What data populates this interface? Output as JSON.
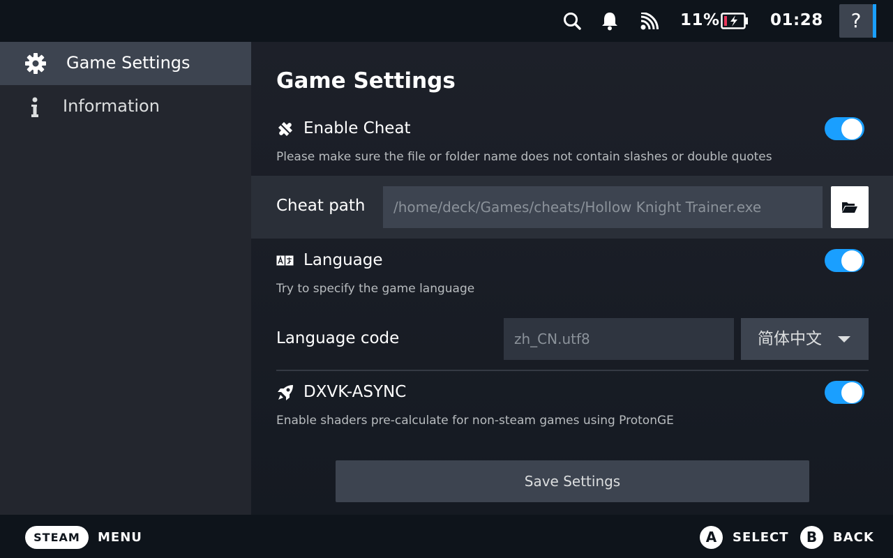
{
  "status_bar": {
    "battery_percent": "11%",
    "time": "01:28",
    "help_label": "?"
  },
  "sidebar": {
    "items": [
      {
        "label": "Game Settings",
        "icon": "gear-icon",
        "active": true
      },
      {
        "label": "Information",
        "icon": "info-icon",
        "active": false
      }
    ]
  },
  "main": {
    "title": "Game Settings",
    "enable_cheat": {
      "label": "Enable Cheat",
      "description": "Please make sure the file or folder name does not contain slashes or double quotes",
      "enabled": true
    },
    "cheat_path": {
      "label": "Cheat path",
      "value": "/home/deck/Games/cheats/Hollow Knight Trainer.exe"
    },
    "language": {
      "label": "Language",
      "description": "Try to specify the game language",
      "enabled": true
    },
    "language_code": {
      "label": "Language code",
      "value": "zh_CN.utf8",
      "selected_option": "简体中文"
    },
    "dxvk_async": {
      "label": "DXVK-ASYNC",
      "description": "Enable shaders pre-calculate for non-steam games using ProtonGE",
      "enabled": true
    },
    "save_label": "Save Settings"
  },
  "bottom_bar": {
    "steam_label": "STEAM",
    "menu_label": "MENU",
    "a_button": "A",
    "select_label": "SELECT",
    "b_button": "B",
    "back_label": "BACK"
  },
  "colors": {
    "accent": "#1a9fff",
    "background": "#0e141b",
    "sidebar": "#23262e",
    "battery_low": "#e8365a"
  }
}
